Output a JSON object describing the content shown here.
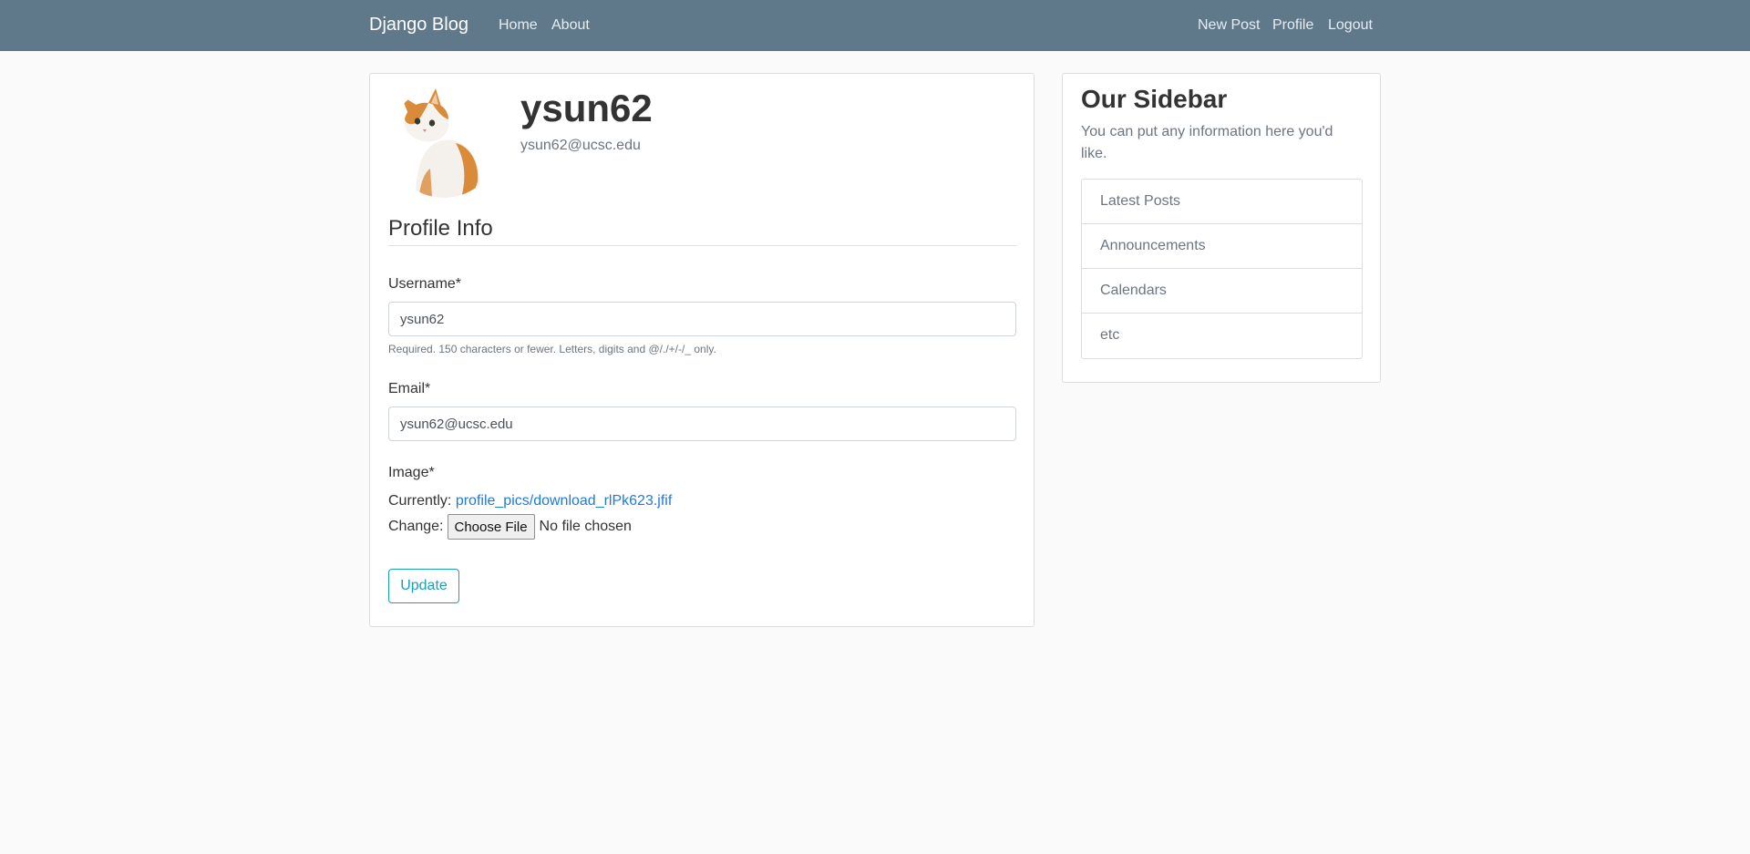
{
  "navbar": {
    "brand": "Django Blog",
    "left_links": [
      "Home",
      "About"
    ],
    "right_links": [
      "New Post",
      "Profile",
      "Logout"
    ],
    "background": "#5f788a"
  },
  "profile": {
    "avatar_icon": "cat-photo",
    "username": "ysun62",
    "email": "ysun62@ucsc.edu"
  },
  "form": {
    "legend": "Profile Info",
    "username": {
      "label": "Username*",
      "value": "ysun62",
      "help": "Required. 150 characters or fewer. Letters, digits and @/./+/-/_ only."
    },
    "email": {
      "label": "Email*",
      "value": "ysun62@ucsc.edu"
    },
    "image": {
      "label": "Image*",
      "currently_label": "Currently:",
      "current_file": "profile_pics/download_rlPk623.jfif",
      "change_label": "Change:",
      "choose_button": "Choose File",
      "no_file_text": "No file chosen"
    },
    "submit": "Update",
    "accent_color": "#17a2b8",
    "link_color": "#1d7bd8"
  },
  "sidebar": {
    "title": "Our Sidebar",
    "description": "You can put any information here you'd like.",
    "items": [
      "Latest Posts",
      "Announcements",
      "Calendars",
      "etc"
    ]
  }
}
